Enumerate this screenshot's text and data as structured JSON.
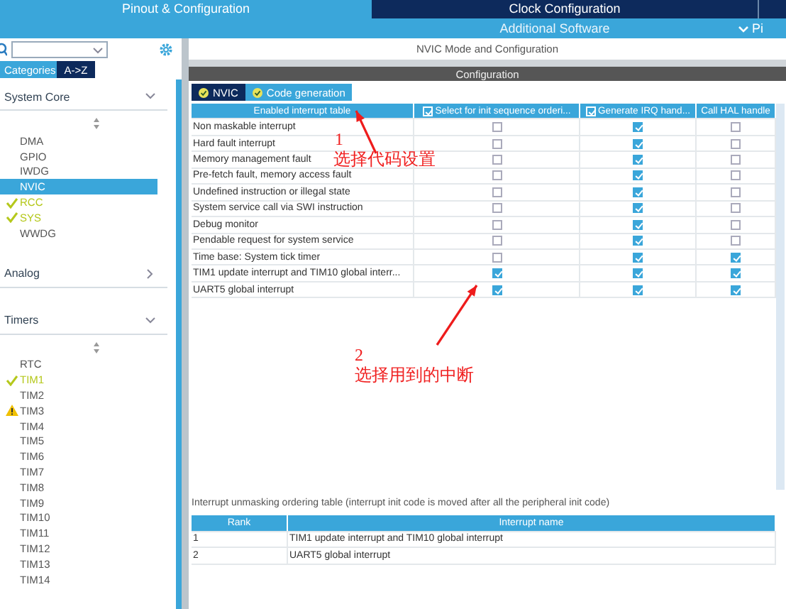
{
  "top_tabs": [
    {
      "label": "Pinout & Configuration",
      "selected": true
    },
    {
      "label": "Clock Configuration",
      "selected": false
    }
  ],
  "sub_bar": {
    "label": "Additional Software",
    "next_label": "Pi"
  },
  "sidebar": {
    "view_tabs": [
      {
        "label": "Categories",
        "selected": true
      },
      {
        "label": "A->Z",
        "selected": false
      }
    ],
    "groups": [
      {
        "label": "System Core",
        "expanded": true,
        "items": [
          {
            "label": "DMA",
            "kind": "plain",
            "selected": false
          },
          {
            "label": "GPIO",
            "kind": "plain",
            "selected": false
          },
          {
            "label": "IWDG",
            "kind": "plain",
            "selected": false
          },
          {
            "label": "NVIC",
            "kind": "plain",
            "selected": true
          },
          {
            "label": "RCC",
            "kind": "configured",
            "selected": false
          },
          {
            "label": "SYS",
            "kind": "configured",
            "selected": false
          },
          {
            "label": "WWDG",
            "kind": "plain",
            "selected": false
          }
        ]
      },
      {
        "label": "Analog",
        "expanded": false
      },
      {
        "label": "Timers",
        "expanded": true,
        "items": [
          {
            "label": "RTC",
            "kind": "plain",
            "selected": false
          },
          {
            "label": "TIM1",
            "kind": "configured",
            "selected": false
          },
          {
            "label": "TIM2",
            "kind": "plain",
            "selected": false
          },
          {
            "label": "TIM3",
            "kind": "warning",
            "selected": false
          },
          {
            "label": "TIM4",
            "kind": "plain",
            "selected": false
          },
          {
            "label": "TIM5",
            "kind": "plain",
            "selected": false
          },
          {
            "label": "TIM6",
            "kind": "plain",
            "selected": false
          },
          {
            "label": "TIM7",
            "kind": "plain",
            "selected": false
          },
          {
            "label": "TIM8",
            "kind": "plain",
            "selected": false
          },
          {
            "label": "TIM9",
            "kind": "plain",
            "selected": false
          },
          {
            "label": "TIM10",
            "kind": "plain",
            "selected": false
          },
          {
            "label": "TIM11",
            "kind": "plain",
            "selected": false
          },
          {
            "label": "TIM12",
            "kind": "plain",
            "selected": false
          },
          {
            "label": "TIM13",
            "kind": "plain",
            "selected": false
          },
          {
            "label": "TIM14",
            "kind": "plain",
            "selected": false
          }
        ]
      }
    ]
  },
  "main": {
    "title": "NVIC Mode and Configuration",
    "section": "Configuration",
    "tabs": [
      {
        "label": "NVIC",
        "selected": false
      },
      {
        "label": "Code generation",
        "selected": true
      }
    ],
    "table": {
      "columns": [
        {
          "label": "Enabled interrupt table",
          "kind": "text"
        },
        {
          "label": "Select for init sequence orderi...",
          "kind": "checkbox",
          "checked": true
        },
        {
          "label": "Generate IRQ hand...",
          "kind": "checkbox",
          "checked": true
        },
        {
          "label": "Call HAL handle",
          "kind": "text"
        }
      ],
      "rows": [
        {
          "name": "Non maskable interrupt",
          "init_order": false,
          "generate_irq": true,
          "call_hal": false
        },
        {
          "name": "Hard fault interrupt",
          "init_order": false,
          "generate_irq": true,
          "call_hal": false
        },
        {
          "name": "Memory management fault",
          "init_order": false,
          "generate_irq": true,
          "call_hal": false
        },
        {
          "name": "Pre-fetch fault, memory access fault",
          "init_order": false,
          "generate_irq": true,
          "call_hal": false
        },
        {
          "name": "Undefined instruction or illegal state",
          "init_order": false,
          "generate_irq": true,
          "call_hal": false
        },
        {
          "name": "System service call via SWI instruction",
          "init_order": false,
          "generate_irq": true,
          "call_hal": false
        },
        {
          "name": "Debug monitor",
          "init_order": false,
          "generate_irq": true,
          "call_hal": false
        },
        {
          "name": "Pendable request for system service",
          "init_order": false,
          "generate_irq": true,
          "call_hal": false
        },
        {
          "name": "Time base: System tick timer",
          "init_order": false,
          "generate_irq": true,
          "call_hal": true
        },
        {
          "name": "TIM1 update interrupt and TIM10 global interr...",
          "init_order": true,
          "generate_irq": true,
          "call_hal": true
        },
        {
          "name": "UART5 global interrupt",
          "init_order": true,
          "generate_irq": true,
          "call_hal": true
        }
      ]
    },
    "order_caption": "Interrupt unmasking ordering table (interrupt init code is moved after all the peripheral init code)",
    "order_table": {
      "columns": [
        "Rank",
        "Interrupt name"
      ],
      "rows": [
        [
          "1",
          "TIM1 update interrupt and TIM10 global interrupt"
        ],
        [
          "2",
          "UART5 global interrupt"
        ]
      ]
    }
  },
  "annotations": [
    {
      "number": "1",
      "text": "选择代码设置"
    },
    {
      "number": "2",
      "text": "选择用到的中断"
    }
  ]
}
